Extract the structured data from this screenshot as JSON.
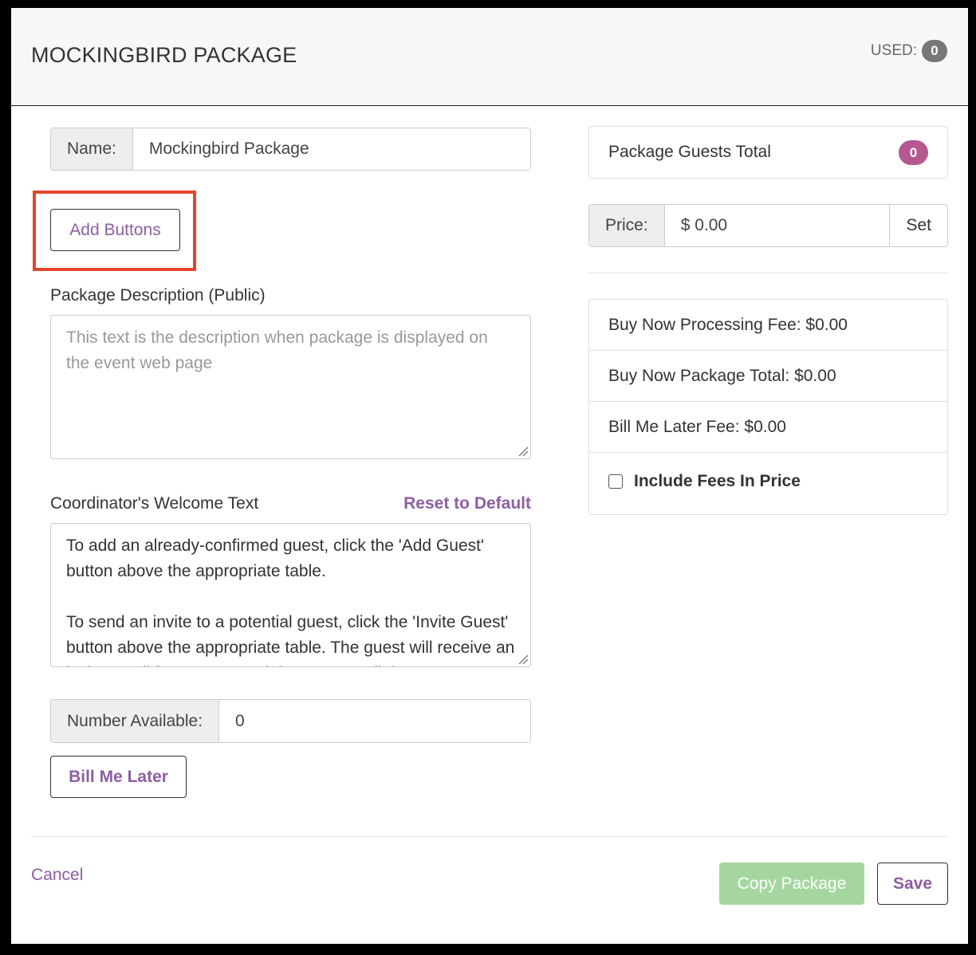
{
  "header": {
    "title": "MOCKINGBIRD PACKAGE",
    "used_label": "USED:",
    "used_count": "0"
  },
  "form": {
    "name_label": "Name:",
    "name_value": "Mockingbird Package",
    "add_buttons_label": "Add Buttons",
    "description_label": "Package Description (Public)",
    "description_placeholder": "This text is the description when package is displayed on the event web page",
    "welcome_label": "Coordinator's Welcome Text",
    "reset_label": "Reset to Default",
    "welcome_para1": "To add an already-confirmed guest, click the 'Add Guest' button above the appropriate table.",
    "welcome_para2": "To send an invite to a potential guest, click the 'Invite Guest' button above the appropriate table. The guest will receive an invite email from you containing a secure link.",
    "number_label": "Number Available:",
    "number_value": "0",
    "bill_me_later_label": "Bill Me Later"
  },
  "summary": {
    "guests_total_label": "Package Guests Total",
    "guests_total_count": "0",
    "price_label": "Price:",
    "price_value": "$ 0.00",
    "set_label": "Set",
    "processing_fee": "Buy Now Processing Fee: $0.00",
    "package_total": "Buy Now Package Total: $0.00",
    "bill_later_fee": "Bill Me Later Fee: $0.00",
    "include_fees_label": "Include Fees In Price",
    "include_fees_checked": false
  },
  "footer": {
    "cancel_label": "Cancel",
    "copy_label": "Copy Package",
    "save_label": "Save"
  },
  "colors": {
    "accent": "#8e5ea2",
    "highlight": "#e4452b",
    "copy_button": "#a5d6a0",
    "guests_badge": "#b5588f",
    "used_badge": "#777777"
  }
}
